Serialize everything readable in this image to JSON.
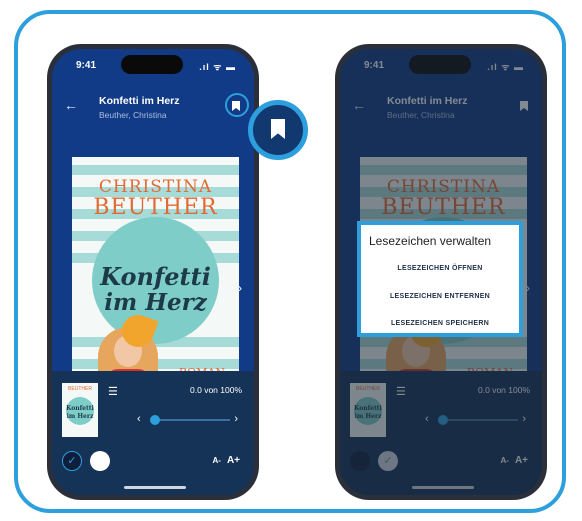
{
  "status": {
    "time": "9:41",
    "system": ".ıl ᯤ ▬"
  },
  "book": {
    "title": "Konfetti im Herz",
    "author": "Beuther, Christina",
    "cover_author_line1": "CHRISTINA",
    "cover_author_line2": "BEUTHER",
    "cover_title_line1": "Konfetti",
    "cover_title_line2": "im Herz",
    "cover_genre": "ROMAN"
  },
  "reader": {
    "progress_text": "0.0 von 100%",
    "progress_fraction": 0.0,
    "font_smaller": "A-",
    "font_larger": "A+",
    "prev_glyph": "‹",
    "next_glyph": "›",
    "toc_icon_glyph": "☰",
    "check_glyph": "✓",
    "back_glyph": "←"
  },
  "dialog": {
    "title": "Lesezeichen verwalten",
    "options": [
      "LESEZEICHEN ÖFFNEN",
      "LESEZEICHEN ENTFERNEN",
      "LESEZEICHEN SPEICHERN"
    ]
  },
  "icons": {
    "bookmark": "bookmark-icon",
    "back": "back-arrow-icon",
    "toc": "list-icon",
    "check": "check-icon"
  },
  "colors": {
    "accent": "#2d9fdd",
    "header": "#113b86",
    "footer": "#153257"
  }
}
